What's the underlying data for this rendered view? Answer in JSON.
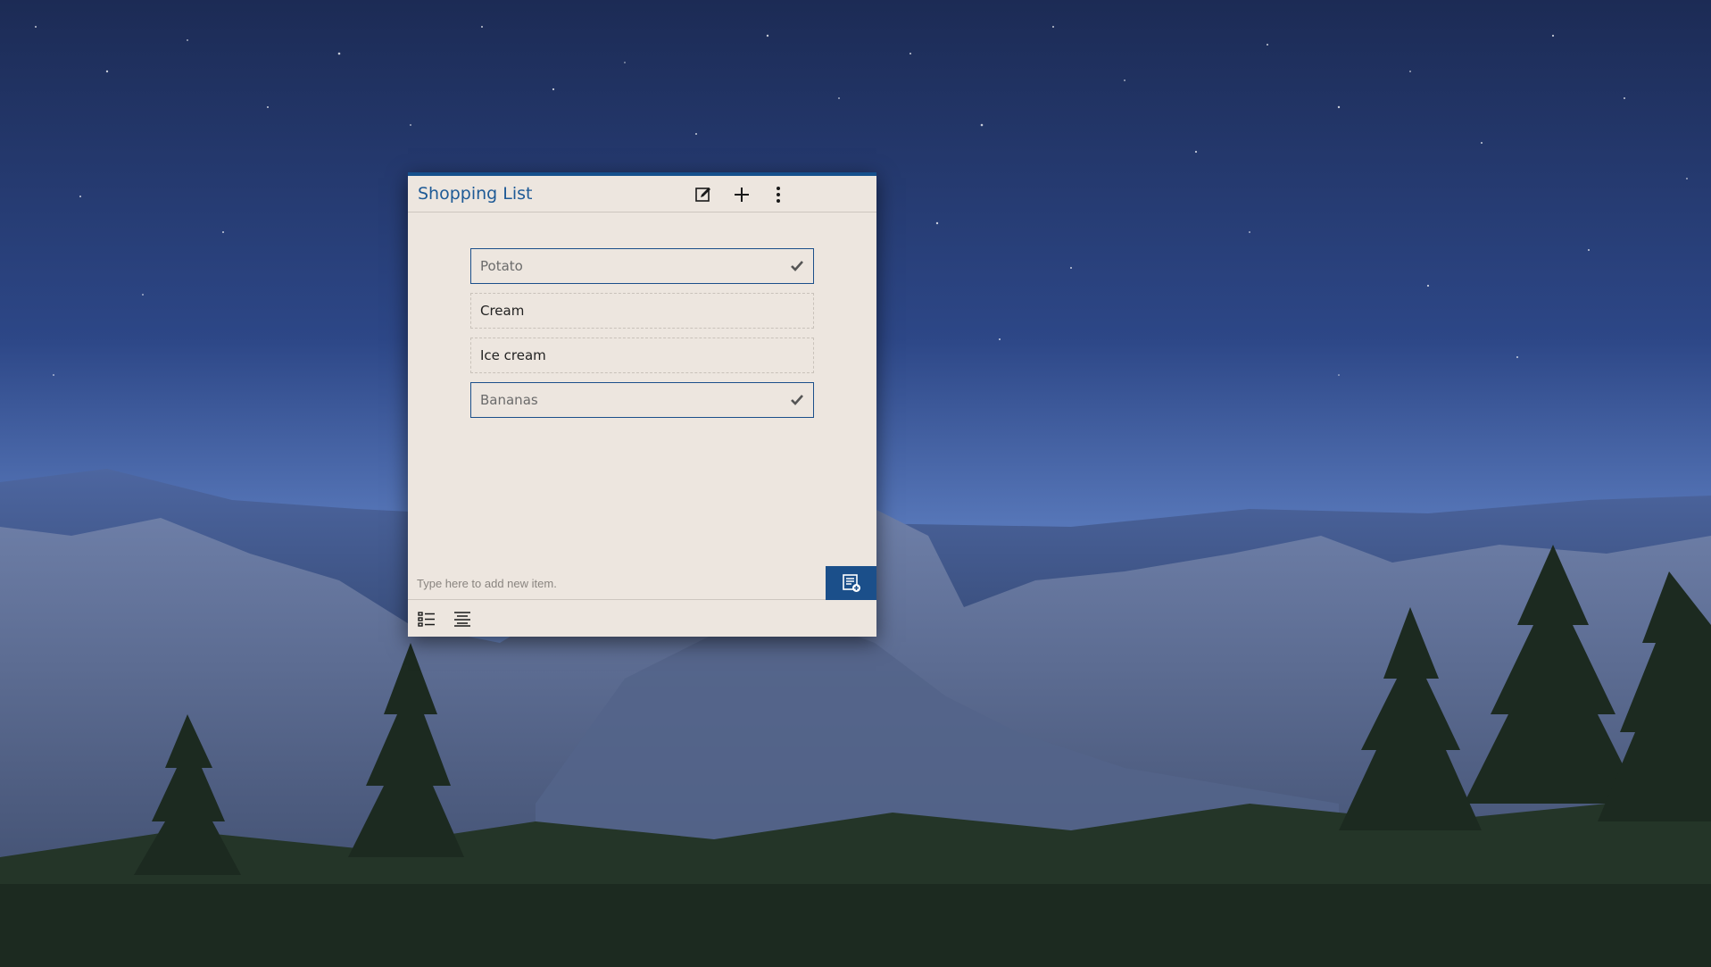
{
  "window": {
    "title": "Shopping List",
    "accent": "#1b4f8a",
    "background": "#ede6df"
  },
  "toolbar": {
    "edit_icon": "edit-icon",
    "add_icon": "plus-icon",
    "menu_icon": "kebab-menu-icon"
  },
  "items": [
    {
      "label": "Potato",
      "checked": true
    },
    {
      "label": "Cream",
      "checked": false
    },
    {
      "label": "Ice cream",
      "checked": false
    },
    {
      "label": "Bananas",
      "checked": true
    }
  ],
  "new_item": {
    "placeholder": "Type here to add new item.",
    "value": ""
  },
  "footer": {
    "list_icon": "list-view-icon",
    "text_icon": "text-view-icon"
  }
}
